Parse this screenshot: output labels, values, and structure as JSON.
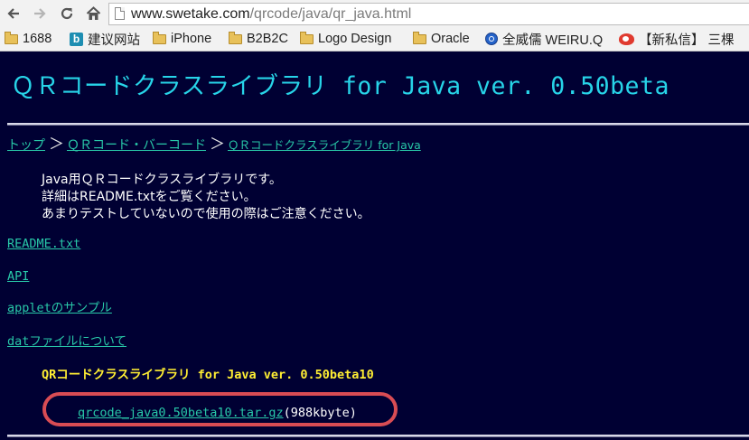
{
  "browser": {
    "url_host": "www.swetake.com",
    "url_path": "/qrcode/java/qr_java.html",
    "nav": {
      "back_icon": "arrow-left-icon",
      "forward_icon": "arrow-right-icon",
      "reload_icon": "reload-icon",
      "home_icon": "home-icon"
    },
    "bookmarks": [
      {
        "label": "1688",
        "icon": "folder-icon"
      },
      {
        "label": "建议网站",
        "icon": "bing-icon"
      },
      {
        "label": "iPhone",
        "icon": "folder-icon"
      },
      {
        "label": "B2B2C",
        "icon": "folder-icon"
      },
      {
        "label": "Logo Design",
        "icon": "folder-icon"
      },
      {
        "label": "Oracle",
        "icon": "folder-icon"
      },
      {
        "label": "全威儒 WEIRU.Q",
        "icon": "globe-icon"
      },
      {
        "label": "【新私信】 三棵",
        "icon": "weibo-icon"
      }
    ]
  },
  "page": {
    "title": "ＱＲコードクラスライブラリ for Java ver. 0.50beta",
    "breadcrumb": {
      "items": [
        "トップ",
        "ＱＲコード・バーコード",
        "ＱＲコードクラスライブラリ for Java"
      ],
      "separator": "＞"
    },
    "intro": [
      "Java用ＱＲコードクラスライブラリです。",
      "詳細はREADME.txtをご覧ください。",
      "あまりテストしていないので使用の際はご注意ください。"
    ],
    "links": {
      "readme": "README.txt",
      "api": "API",
      "applet_prefix": "applet",
      "applet_suffix": "のサンプル",
      "dat_prefix": "dat",
      "dat_suffix": "ファイルについて"
    },
    "release": {
      "title_prefix": "QR",
      "title_jp": "コードクラスライブラリ",
      "title_suffix": " for Java ver. 0.50beta10",
      "download_file": "qrcode_java0.50beta10.tar.gz",
      "download_size": "(988kbyte)"
    }
  },
  "colors": {
    "page_background": "#000033",
    "title": "#27d4e8",
    "link": "#28c8a8",
    "body_text": "#ffffff",
    "release_title": "#ffee33",
    "highlight": "#d84c54"
  }
}
